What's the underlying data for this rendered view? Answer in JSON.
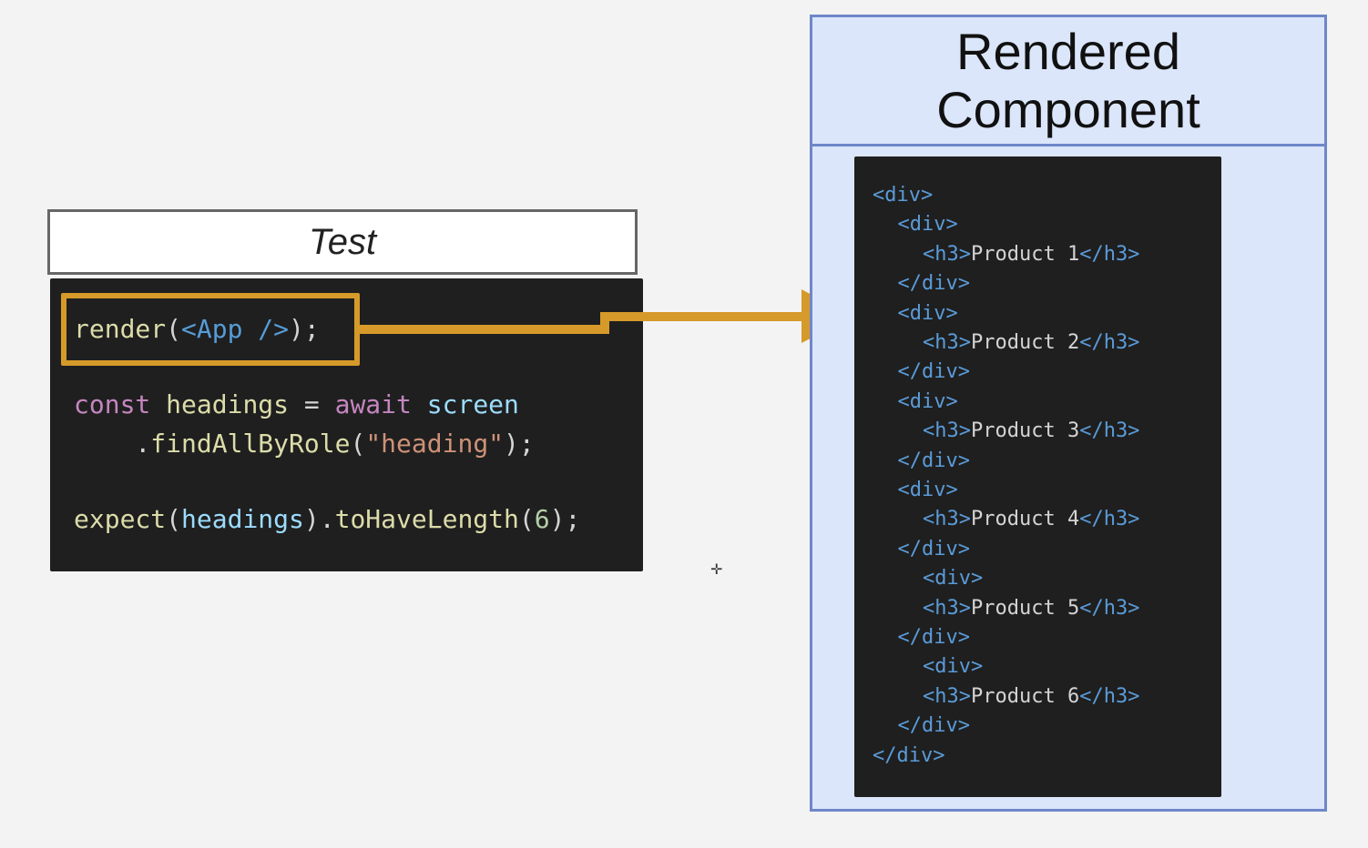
{
  "test_box": {
    "title": "Test"
  },
  "test_code": {
    "line1": [
      {
        "text": "render",
        "role": "fn"
      },
      {
        "text": "(",
        "role": "punct"
      },
      {
        "text": "<App />",
        "role": "tag"
      },
      {
        "text": ");",
        "role": "punct"
      }
    ],
    "line2": [
      {
        "text": "const ",
        "role": "kw"
      },
      {
        "text": "headings ",
        "role": "fn"
      },
      {
        "text": "= ",
        "role": "punct"
      },
      {
        "text": "await ",
        "role": "kw"
      },
      {
        "text": "screen",
        "role": "var"
      }
    ],
    "line3": [
      {
        "text": "    .",
        "role": "punct"
      },
      {
        "text": "findAllByRole",
        "role": "fn"
      },
      {
        "text": "(",
        "role": "punct"
      },
      {
        "text": "\"heading\"",
        "role": "str"
      },
      {
        "text": ");",
        "role": "punct"
      }
    ],
    "line4": [
      {
        "text": "expect",
        "role": "fn"
      },
      {
        "text": "(",
        "role": "punct"
      },
      {
        "text": "headings",
        "role": "var"
      },
      {
        "text": ").",
        "role": "punct"
      },
      {
        "text": "toHaveLength",
        "role": "fn"
      },
      {
        "text": "(",
        "role": "punct"
      },
      {
        "text": "6",
        "role": "num"
      },
      {
        "text": ");",
        "role": "punct"
      }
    ]
  },
  "rendered_box": {
    "title_line1": "Rendered",
    "title_line2": "Component"
  },
  "rendered_html": [
    {
      "indent": 0,
      "parts": [
        {
          "text": "<div>",
          "role": "tag"
        }
      ]
    },
    {
      "indent": 1,
      "parts": [
        {
          "text": "<div>",
          "role": "tag"
        }
      ]
    },
    {
      "indent": 2,
      "parts": [
        {
          "text": "<h3>",
          "role": "tag"
        },
        {
          "text": "Product 1",
          "role": "txt"
        },
        {
          "text": "</h3>",
          "role": "tag"
        }
      ]
    },
    {
      "indent": 1,
      "parts": [
        {
          "text": "</div>",
          "role": "tag"
        }
      ]
    },
    {
      "indent": 1,
      "parts": [
        {
          "text": "<div>",
          "role": "tag"
        }
      ]
    },
    {
      "indent": 2,
      "parts": [
        {
          "text": "<h3>",
          "role": "tag"
        },
        {
          "text": "Product 2",
          "role": "txt"
        },
        {
          "text": "</h3>",
          "role": "tag"
        }
      ]
    },
    {
      "indent": 1,
      "parts": [
        {
          "text": "</div>",
          "role": "tag"
        }
      ]
    },
    {
      "indent": 1,
      "parts": [
        {
          "text": "<div>",
          "role": "tag"
        }
      ]
    },
    {
      "indent": 2,
      "parts": [
        {
          "text": "<h3>",
          "role": "tag"
        },
        {
          "text": "Product 3",
          "role": "txt"
        },
        {
          "text": "</h3>",
          "role": "tag"
        }
      ]
    },
    {
      "indent": 1,
      "parts": [
        {
          "text": "</div>",
          "role": "tag"
        }
      ]
    },
    {
      "indent": 1,
      "parts": [
        {
          "text": "<div>",
          "role": "tag"
        }
      ]
    },
    {
      "indent": 2,
      "parts": [
        {
          "text": "<h3>",
          "role": "tag"
        },
        {
          "text": "Product 4",
          "role": "txt"
        },
        {
          "text": "</h3>",
          "role": "tag"
        }
      ]
    },
    {
      "indent": 1,
      "parts": [
        {
          "text": "</div>",
          "role": "tag"
        }
      ]
    },
    {
      "indent": 2,
      "parts": [
        {
          "text": "<div>",
          "role": "tag"
        }
      ]
    },
    {
      "indent": 2,
      "parts": [
        {
          "text": "<h3>",
          "role": "tag"
        },
        {
          "text": "Product 5",
          "role": "txt"
        },
        {
          "text": "</h3>",
          "role": "tag"
        }
      ]
    },
    {
      "indent": 1,
      "parts": [
        {
          "text": "</div>",
          "role": "tag"
        }
      ]
    },
    {
      "indent": 2,
      "parts": [
        {
          "text": "<div>",
          "role": "tag"
        }
      ]
    },
    {
      "indent": 2,
      "parts": [
        {
          "text": "<h3>",
          "role": "tag"
        },
        {
          "text": "Product 6",
          "role": "txt"
        },
        {
          "text": "</h3>",
          "role": "tag"
        }
      ]
    },
    {
      "indent": 1,
      "parts": [
        {
          "text": "</div>",
          "role": "tag"
        }
      ]
    },
    {
      "indent": 0,
      "parts": [
        {
          "text": "</div>",
          "role": "tag"
        }
      ]
    }
  ],
  "colors": {
    "highlight": "#d69a2a",
    "panel_border": "#6f87c9",
    "panel_fill": "#dbe6fb",
    "code_bg": "#1f1f1f"
  },
  "cursor_icon": "move-cursor-icon"
}
